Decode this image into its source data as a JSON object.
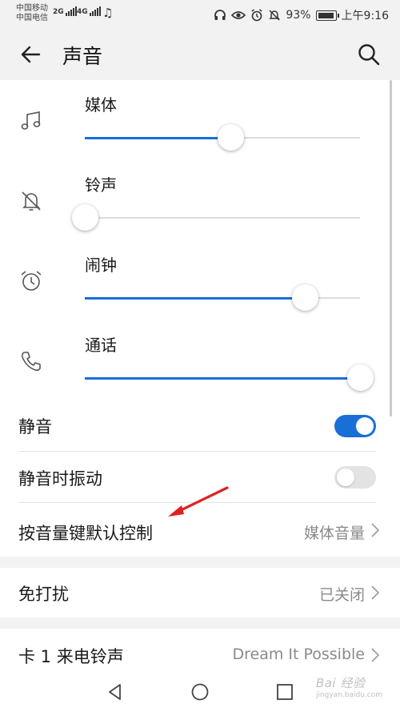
{
  "status_bar": {
    "carrier1": "中国移动",
    "carrier2": "中国电信",
    "net1": "2G",
    "net2": "4G",
    "battery": "93%",
    "time": "上午9:16",
    "icons": [
      "music-note-icon",
      "headset-icon",
      "eye-icon",
      "alarm-icon",
      "mute-icon",
      "battery-icon"
    ]
  },
  "header": {
    "title": "声音",
    "back_icon": "arrow-left-icon",
    "search_icon": "search-icon"
  },
  "volumes": [
    {
      "label": "媒体",
      "icon": "music-note-icon",
      "level": 0.53
    },
    {
      "label": "铃声",
      "icon": "bell-off-icon",
      "level": 0.0
    },
    {
      "label": "闹钟",
      "icon": "alarm-clock-icon",
      "level": 0.8
    },
    {
      "label": "通话",
      "icon": "phone-icon",
      "level": 1.0
    }
  ],
  "settings": {
    "mute_label": "静音",
    "mute_on": true,
    "vibrate_label": "静音时振动",
    "vibrate_on": false,
    "volume_key_label": "按音量键默认控制",
    "volume_key_value": "媒体音量",
    "dnd_label": "免打扰",
    "dnd_value": "已关闭",
    "ringtone_label": "卡 1 来电铃声",
    "ringtone_value": "Dream It Possible"
  },
  "watermark": {
    "text": "Bai 经验",
    "sub": "jingyan.baidu.com"
  },
  "colors": {
    "accent": "#1a6ed8",
    "annotation": "#e02020",
    "background": "#f2f2f2"
  }
}
